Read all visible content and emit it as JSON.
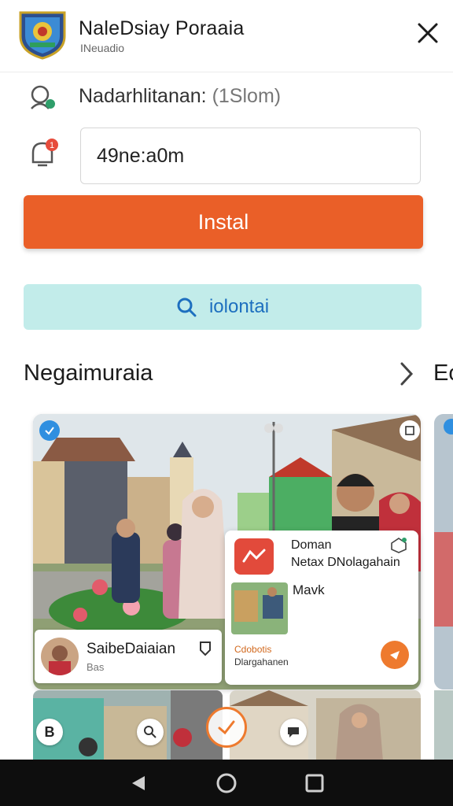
{
  "header": {
    "title": "NaleDsiay Poraaia",
    "subtitle": "INeuadio",
    "logo_icon": "shield-emblem-icon",
    "close_icon": "close-icon"
  },
  "info": {
    "label": "Nadarhlitanan:",
    "detail": "(1Slom)",
    "icon": "user-location-icon"
  },
  "code_field": {
    "value": "49ne:a0m",
    "icon": "notification-bell-icon",
    "badge": "1"
  },
  "install_button": {
    "label": "Instal",
    "color": "#ea5f28"
  },
  "search_button": {
    "label": "iolontai",
    "icon": "search-icon",
    "color": "#c2ecea"
  },
  "section": {
    "title": "Negaimuraia",
    "next_title": "Eo",
    "chevron_icon": "chevron-right-icon"
  },
  "featured_card": {
    "name": "SaibeDaiaian",
    "meta": "Bas",
    "pin_icon": "map-pin-icon"
  },
  "promo_card": {
    "title": "Doman",
    "subtitle": "Netax DNolagahain",
    "label": "Mavk",
    "foot_line1": "Cdobotis",
    "foot_line2": "Dlargahanen",
    "accent": "#ee7a2e"
  },
  "navbar": {
    "back_icon": "back-triangle-icon",
    "home_icon": "home-circle-icon",
    "recents_icon": "recents-square-icon"
  }
}
